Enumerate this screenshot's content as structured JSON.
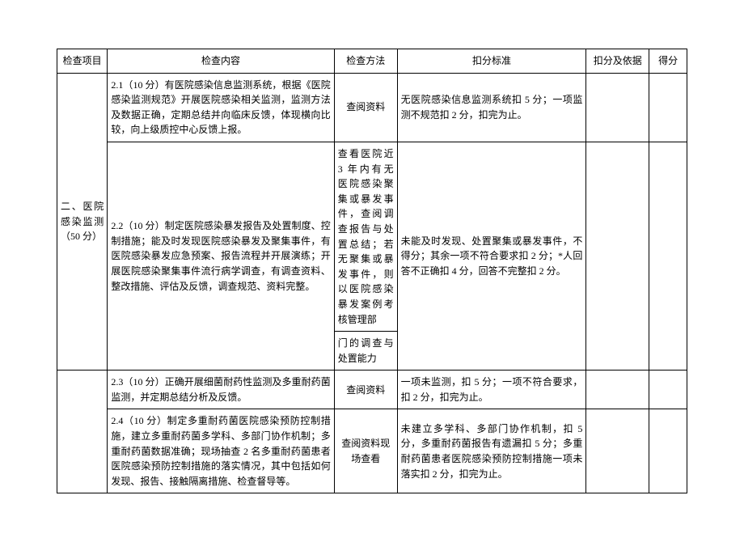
{
  "headers": {
    "item": "检查项目",
    "content": "检查内容",
    "method": "检查方法",
    "std": "扣分标准",
    "basis": "扣分及依据",
    "score": "得分"
  },
  "sectionTitle": "二、医院感染监测（50 分）",
  "rows": [
    {
      "content": "2.1（10 分）有医院感染信息监测系统，根据《医院感染监测规范》开展医院感染相关监测，监测方法及数据正确，定期总结并向临床反馈，体现横向比较，向上级质控中心反馈上报。",
      "method": "查阅资料",
      "std": "无医院感染信息监测系统扣 5 分；一项监测不规范扣 2 分，扣完为止。"
    },
    {
      "content": "2.2（10 分）制定医院感染暴发报告及处置制度、控制措施；能及时发现医院感染暴发及聚集事件，有医院感染暴发应急预案、报告流程并开展演练；开展医院感染聚集事件流行病学调查，有调查资料、整改措施、评估及反馈，调查规范、资料完整。",
      "methodMain": "查看医院近 3 年内有无医院感染聚集或暴发事件，查阅调查报告与处置总结；若无聚集或暴发事件，则以医院感染暴发案例考核管理部",
      "methodTail": "门的调查与处置能力",
      "std": "未能及时发现、处置聚集或暴发事件，不得分；其余一项不符合要求扣 2 分；*人回答不正确扣 4 分，回答不完整扣 2 分。"
    },
    {
      "content": "2.3（10 分）正确开展细菌耐药性监测及多重耐药菌监测，并定期总结分析及反馈。",
      "method": "查阅资料",
      "std": "一项未监测，扣 5 分；一项不符合要求，扣 2 分，扣完为止。"
    },
    {
      "content": "2.4（10 分）制定多重耐药菌医院感染预防控制措施，建立多重耐药菌多学科、多部门协作机制；多重耐药菌数据准确；现场抽查 2 名多重耐药菌患者医院感染预防控制措施的落实情况，其中包括如何发现、报告、接触隔离措施、检查督导等。",
      "method": "查阅资料现场查看",
      "std": "未建立多学科、多部门协作机制，扣 5 分，多重耐药菌报告有遗漏扣 5 分；多重耐药菌患者医院感染预防控制措施一项未落实扣 2 分，扣完为止。"
    }
  ]
}
